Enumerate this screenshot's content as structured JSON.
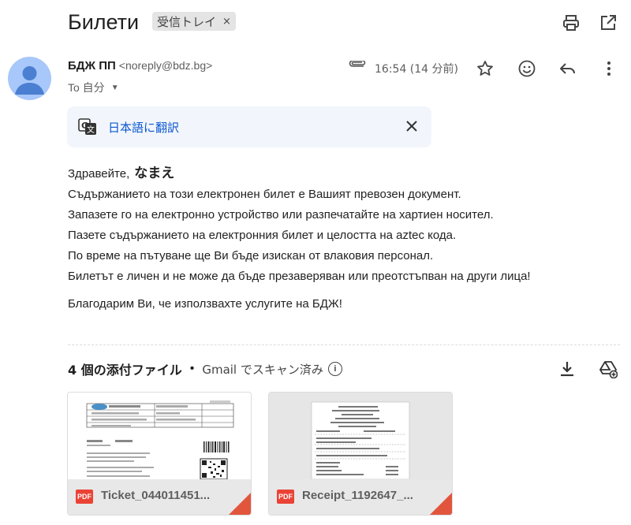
{
  "subject": "Билети",
  "label": "受信トレイ",
  "label_close": "×",
  "sender": {
    "name": "БДЖ ПП",
    "email": "<noreply@bdz.bg>",
    "to": "To 自分",
    "time": "16:54 (14 分前)"
  },
  "translate": {
    "link": "日本語に翻訳"
  },
  "body": {
    "greeting": "Здравейте,",
    "name": "なまえ",
    "lines": [
      "Съдържанието на този електронен билет е Вашият превозен документ.",
      "Запазете го на електронно устройство или разпечатайте на хартиен носител.",
      "Пазете съдържанието на електронния билет и целостта на aztec кода.",
      "По време на пътуване ще Ви бъде изискан от влаковия персонал.",
      "Билетът е личен и не може да бъде презаверяван или преотстъпван на други лица!"
    ],
    "thanks": "Благодарим Ви, че използвахте услугите на БДЖ!"
  },
  "attachments": {
    "count_label": "4 個の添付ファイル",
    "separator": "•",
    "scan_label": "Gmail でスキャン済み",
    "info_label": "i",
    "files": [
      {
        "name": "Ticket_044011451...",
        "type": "PDF"
      },
      {
        "name": "Receipt_1192647_...",
        "type": "PDF"
      }
    ]
  },
  "icons": [
    "print-icon",
    "open-in-new-window-icon",
    "paperclip-icon",
    "star-icon",
    "emoji-icon",
    "reply-icon",
    "more-vert-icon",
    "google-translate-icon",
    "close-icon",
    "download-icon",
    "add-to-drive-icon",
    "pdf-icon"
  ],
  "colors": {
    "accent": "#0b57d0",
    "avatar": "#a8c7fa",
    "avatar_figure": "#4a7fd1",
    "pdf": "#ea4335"
  }
}
